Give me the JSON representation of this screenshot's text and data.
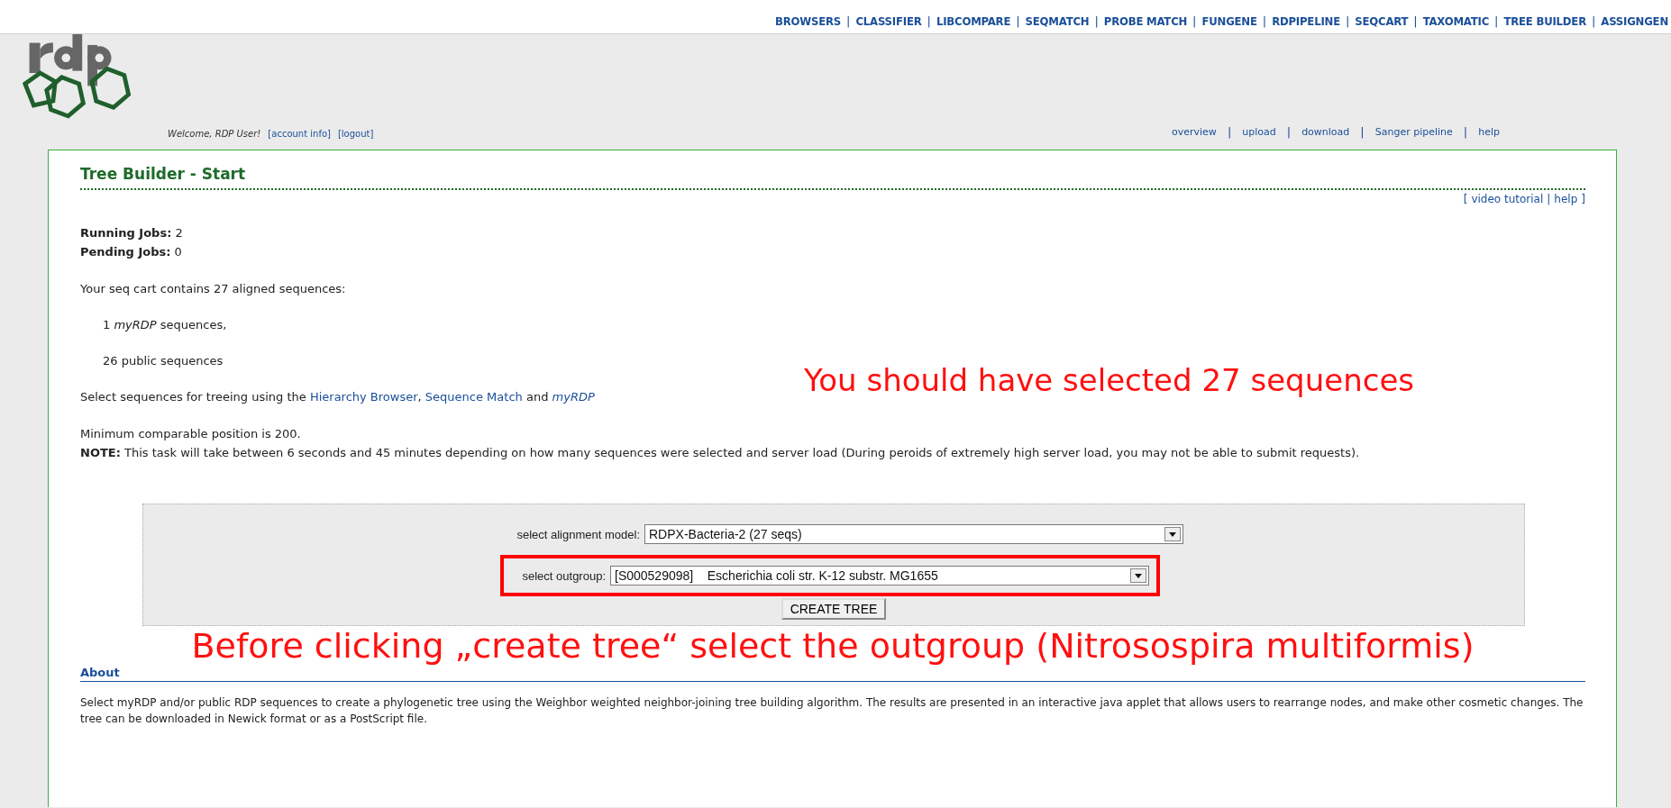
{
  "top_nav": {
    "separator": "|",
    "items": [
      {
        "label": "BROWSERS"
      },
      {
        "label": "CLASSIFIER"
      },
      {
        "label": "LIBCOMPARE"
      },
      {
        "label": "SEQMATCH"
      },
      {
        "label": "PROBE MATCH"
      },
      {
        "label": "FUNGENE"
      },
      {
        "label": "RDPIPELINE"
      },
      {
        "label": "SEQCART"
      },
      {
        "label": "TAXOMATIC"
      },
      {
        "label": "TREE BUILDER"
      },
      {
        "label": "ASSIGNGEN"
      }
    ]
  },
  "header": {
    "welcome": "Welcome, RDP User!",
    "account_links": [
      "[account info]",
      "[logout]"
    ],
    "separator": "|",
    "links": [
      "overview",
      "upload",
      "download",
      "Sanger pipeline",
      "help"
    ]
  },
  "panel": {
    "title": "Tree Builder - Start",
    "help_links": {
      "open": "[",
      "close": "]",
      "separator": "|",
      "items": [
        "video tutorial",
        "help"
      ]
    },
    "jobs": [
      "**Running Jobs:** 2",
      "**Pending Jobs:** 0"
    ],
    "cart_summary": "Your seq cart contains 27 aligned sequences:",
    "cart_items": [
      "1 *myRDP* sequences,",
      "26 public sequences"
    ],
    "select_sentence": [
      {
        "kind": "text",
        "text": "Select sequences for treeing using the"
      },
      {
        "kind": "link",
        "text": "Hierarchy Browser",
        "italic": false
      },
      {
        "kind": "text",
        "text": ",",
        "joined": true
      },
      {
        "kind": "link",
        "text": "Sequence Match",
        "italic": false
      },
      {
        "kind": "text",
        "text": "and"
      },
      {
        "kind": "link",
        "text": "myRDP",
        "italic": true
      }
    ],
    "min_position": "Minimum comparable position is 200.",
    "note": "**NOTE:** This task will take between 6 seconds and 45 minutes depending on how many sequences were selected and server load (During peroids of extremely high server load, you may not be able to submit requests).",
    "form": {
      "fields": [
        {
          "label": "select alignment model:",
          "value": "RDPX-Bacteria-2 (27 seqs)",
          "highlighted": false
        },
        {
          "label": "select outgroup:",
          "value": "[S000529098]    Escherichia coli str. K-12 substr. MG1655",
          "highlighted": true
        }
      ],
      "button": "CREATE TREE"
    },
    "about": {
      "title": "About",
      "text": "Select myRDP and/or public RDP sequences to create a phylogenetic tree using the Weighbor weighted neighbor-joining tree building algorithm. The results are presented in an interactive java applet that allows users to rearrange nodes, and make other cosmetic changes. The tree can be downloaded in Newick format or as a PostScript file."
    }
  },
  "annotations": [
    "You should have selected 27 sequences",
    "Before clicking „create tree“ select the outgroup (Nitrosospira multiformis)"
  ]
}
